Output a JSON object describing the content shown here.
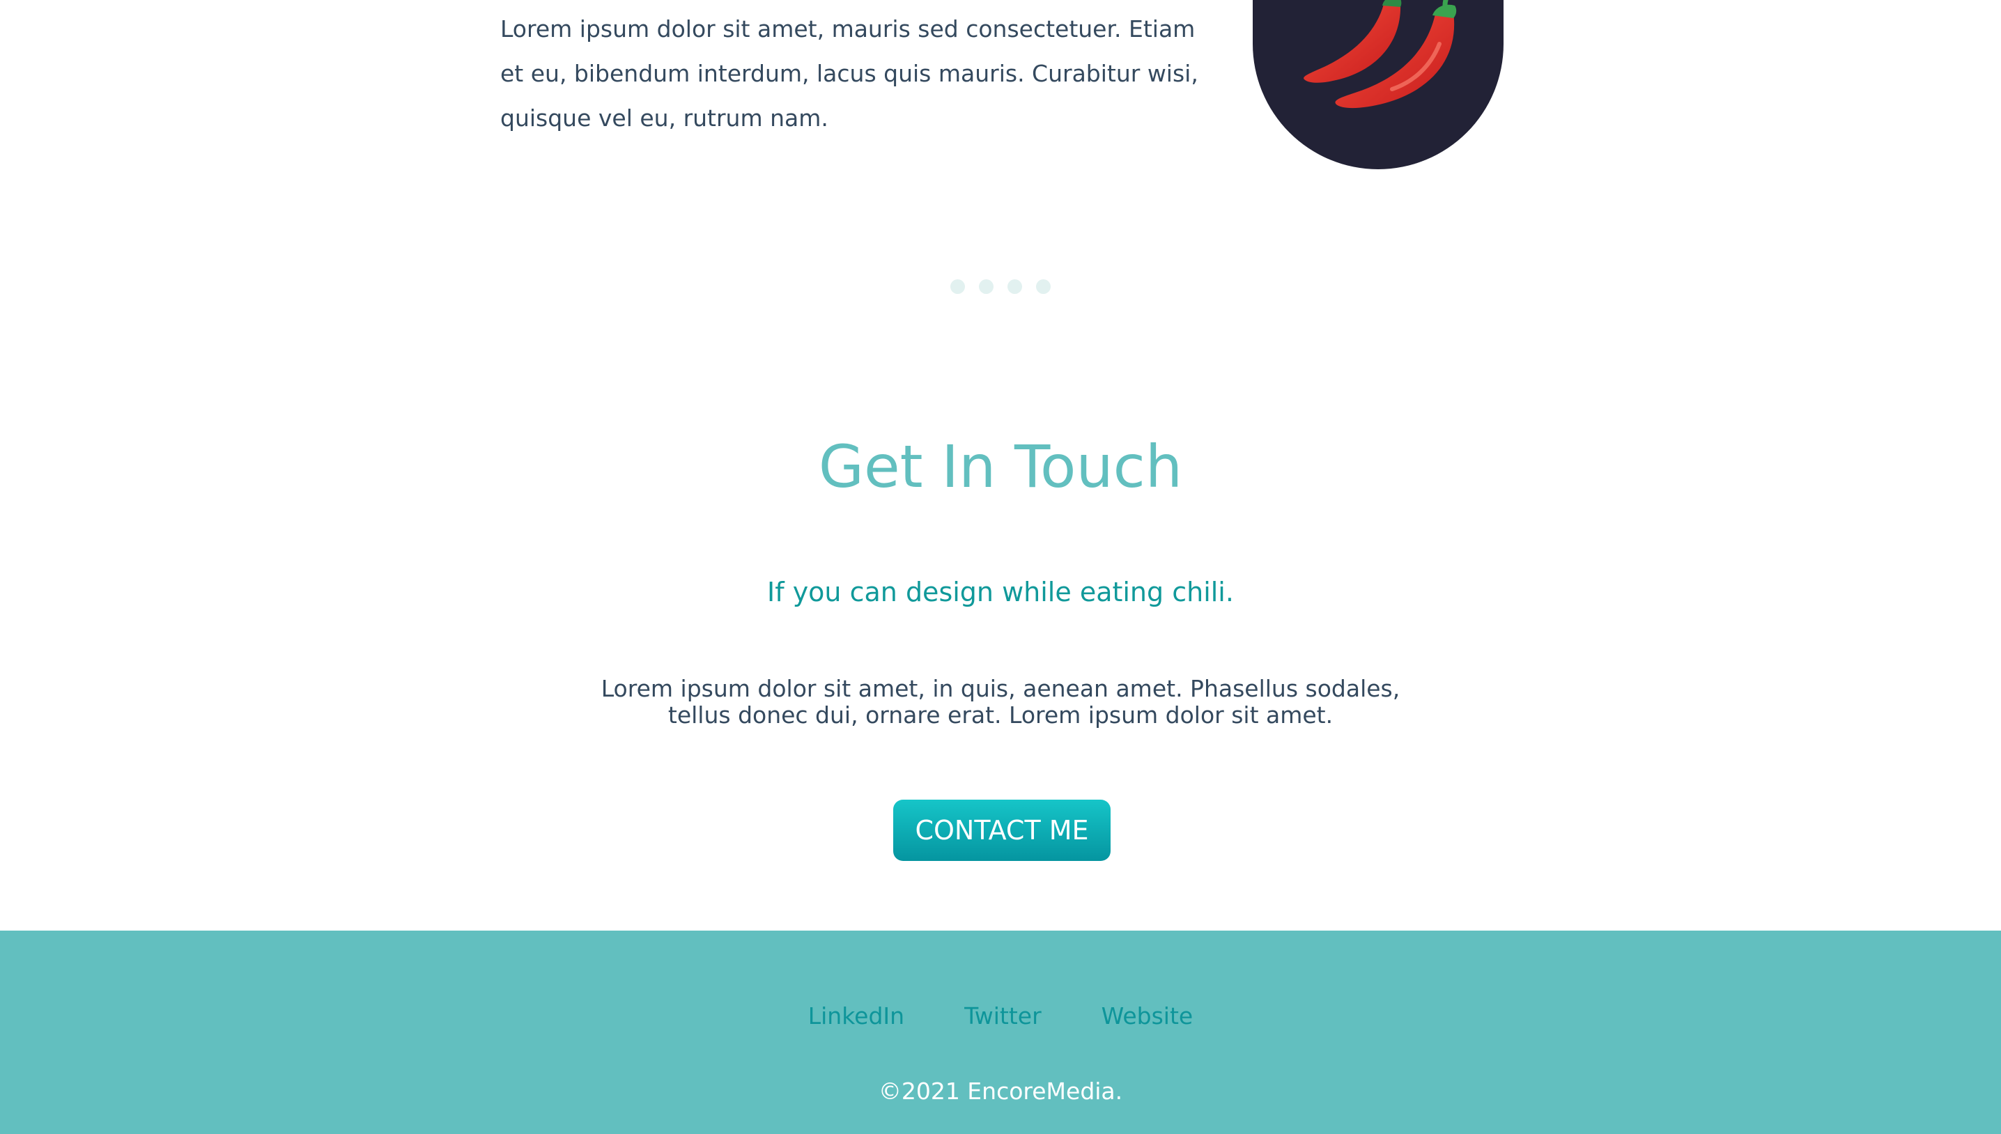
{
  "carousel": {
    "testimonial_text": "Lorem ipsum dolor sit amet, mauris sed consectetuer. Etiam et eu, bibendum interdum, lacus quis mauris. Curabitur wisi, quisque vel eu, rutrum nam.",
    "avatar_icon": "chili-pepper-icon",
    "dot_count": 4
  },
  "contact": {
    "title": "Get In Touch",
    "subtitle": "If you can design while eating chili.",
    "body_line_1": "Lorem ipsum dolor sit amet, in quis, aenean amet. Phasellus sodales,",
    "body_line_2": "tellus donec dui, ornare erat. Lorem ipsum dolor sit amet.",
    "button_label": "CONTACT ME"
  },
  "footer": {
    "links": [
      {
        "label": "LinkedIn"
      },
      {
        "label": "Twitter"
      },
      {
        "label": "Website"
      }
    ],
    "copyright": "©2021 EncoreMedia."
  },
  "colors": {
    "accent": "#62bfbf",
    "accent_dark": "#10999a",
    "avatar_bg": "#222236",
    "text": "#34495e",
    "button_top": "#16c5c8",
    "button_bottom": "#0595a0"
  }
}
